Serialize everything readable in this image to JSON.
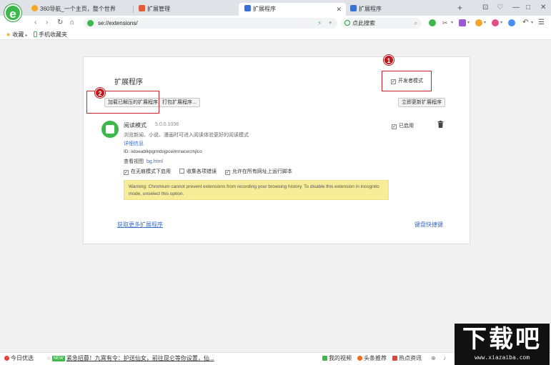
{
  "browser": {
    "logo_glyph": "e",
    "tabs": [
      {
        "label": "360导航_一个主页，整个世界"
      },
      {
        "label": "扩展管理"
      },
      {
        "label": "扩展程序",
        "active": true
      },
      {
        "label": "扩展程序"
      }
    ],
    "new_tab": "+",
    "address_url": "se://extensions/",
    "search_text": "点此搜索",
    "bookmarks": [
      {
        "label": "收藏"
      },
      {
        "label": "手机收藏夹"
      }
    ]
  },
  "extensions_page": {
    "title": "扩展程序",
    "developer_mode_label": "开发者模式",
    "developer_mode_checked": true,
    "load_unpacked_button": "加载已解压的扩展程序...",
    "pack_button": "打包扩展程序...",
    "update_button": "立即更新扩展程序",
    "extension": {
      "name": "阅读模式",
      "version": "5.0.0.1036",
      "enabled_label": "已启用",
      "enabled": true,
      "description": "浏览新闻、小说、漫画时可进入阅读体验更好的阅读模式",
      "details_link": "详细信息",
      "id_text": "ID: iidoeablkpgmldojpceilmnacecmjlco",
      "views_label": "查看视图",
      "views_link": "bg.html",
      "options": [
        {
          "label": "在无痕模式下启用",
          "checked": true
        },
        {
          "label": "收集各项错误",
          "checked": false
        },
        {
          "label": "允许在所有网址上运行脚本",
          "checked": true
        }
      ],
      "warning": "Warning: Chromium cannot prevent extensions from recording your browsing history. To disable this extension in incognito mode, unselect this option."
    },
    "more_link": "获取更多扩展程序",
    "shortcuts_link": "键盘快捷键"
  },
  "annotations": {
    "step1": "1",
    "step2": "2",
    "color": "#d0212b"
  },
  "statusbar": {
    "today_picks": "今日优选",
    "news_badge": "NEW",
    "news_text": "紧急招募！九霄有令：护送仙女，前往昆仑等你设置，仙...",
    "video": "我的视频",
    "headlines": "头条推荐",
    "hot_news": "热点资讯"
  },
  "watermark": {
    "main_text": "下载吧",
    "sub_text": "www.xiazaiba.com"
  }
}
